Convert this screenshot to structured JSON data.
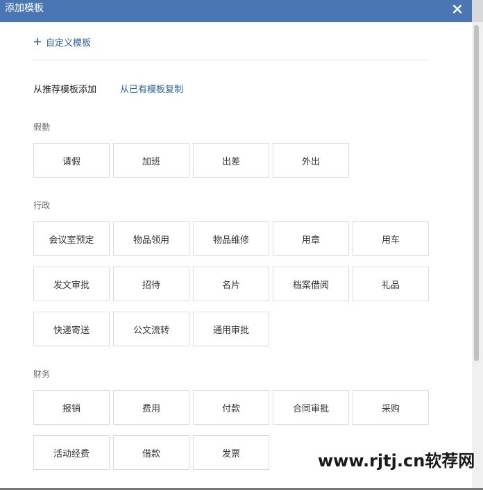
{
  "dialog": {
    "title": "添加模板",
    "close_icon": "close-icon",
    "custom_template_label": "自定义模板",
    "tabs": {
      "recommended": "从推荐模板添加",
      "copy_existing": "从已有模板复制"
    }
  },
  "sections": [
    {
      "title": "假勤",
      "items": [
        "请假",
        "加班",
        "出差",
        "外出"
      ]
    },
    {
      "title": "行政",
      "items": [
        "会议室预定",
        "物品领用",
        "物品维修",
        "用章",
        "用车",
        "发文审批",
        "招待",
        "名片",
        "档案借阅",
        "礼品",
        "快递寄送",
        "公文流转",
        "通用审批"
      ]
    },
    {
      "title": "财务",
      "items": [
        "报销",
        "费用",
        "付款",
        "合同审批",
        "采购",
        "活动经费",
        "借款",
        "发票"
      ]
    }
  ],
  "watermark": "www.rjtj.cn软荐网",
  "colors": {
    "titlebar": "#4a77b4",
    "link": "#2d5f99"
  }
}
